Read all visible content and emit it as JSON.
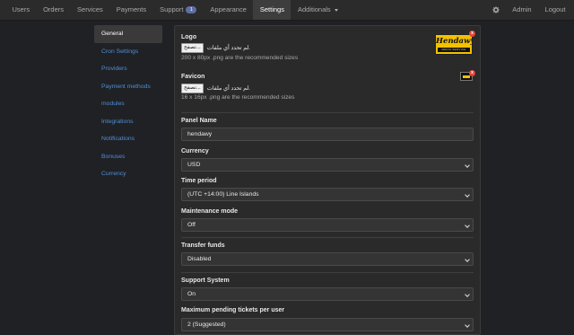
{
  "nav": {
    "items": [
      {
        "label": "Users"
      },
      {
        "label": "Orders"
      },
      {
        "label": "Services"
      },
      {
        "label": "Payments"
      },
      {
        "label": "Support",
        "badge": "1"
      },
      {
        "label": "Appearance"
      },
      {
        "label": "Settings",
        "active": true
      },
      {
        "label": "Additionals"
      }
    ],
    "right": {
      "settings_icon": "gear-icon",
      "admin": "Admin",
      "logout": "Logout"
    }
  },
  "sidebar": {
    "items": [
      {
        "label": "General"
      },
      {
        "label": "Cron Settings"
      },
      {
        "label": "Providers"
      },
      {
        "label": "Payment methods"
      },
      {
        "label": "modules"
      },
      {
        "label": "Integrations"
      },
      {
        "label": "Notifications"
      },
      {
        "label": "Bonuses"
      },
      {
        "label": "Currency"
      }
    ]
  },
  "form": {
    "logo": {
      "label": "Logo",
      "button": "تصفح...",
      "file_text": "لم تحدد أي ملفات.",
      "hint": "200 x 80px .png are the recommended sizes",
      "image_title": "Hendawy",
      "image_subtitle": "MEDIA SERVICE"
    },
    "favicon": {
      "label": "Favicon",
      "button": "تصفح...",
      "file_text": "لم تحدد أي ملفات.",
      "hint": "16 x 16px .png are the recommended sizes"
    },
    "delete_mark": "x",
    "panel_name": {
      "label": "Panel Name",
      "value": "hendawy"
    },
    "currency": {
      "label": "Currency",
      "value": "USD"
    },
    "time_period": {
      "label": "Time period",
      "value": "(UTC +14:00) Line Islands"
    },
    "maintenance": {
      "label": "Maintenance mode",
      "value": "Off"
    },
    "transfer_funds": {
      "label": "Transfer funds",
      "value": "Disabled"
    },
    "support_system": {
      "label": "Support System",
      "value": "On"
    },
    "max_tickets": {
      "label": "Maximum pending tickets per user",
      "value": "2 (Suggested)"
    }
  },
  "colors": {
    "background": "#202124",
    "navbar": "#2b2b2b",
    "panel": "#2a2a2a",
    "link": "#4f8ed6",
    "badge": "#5d6fa3",
    "delete": "#e0473b",
    "logo_yellow": "#f2c200"
  }
}
